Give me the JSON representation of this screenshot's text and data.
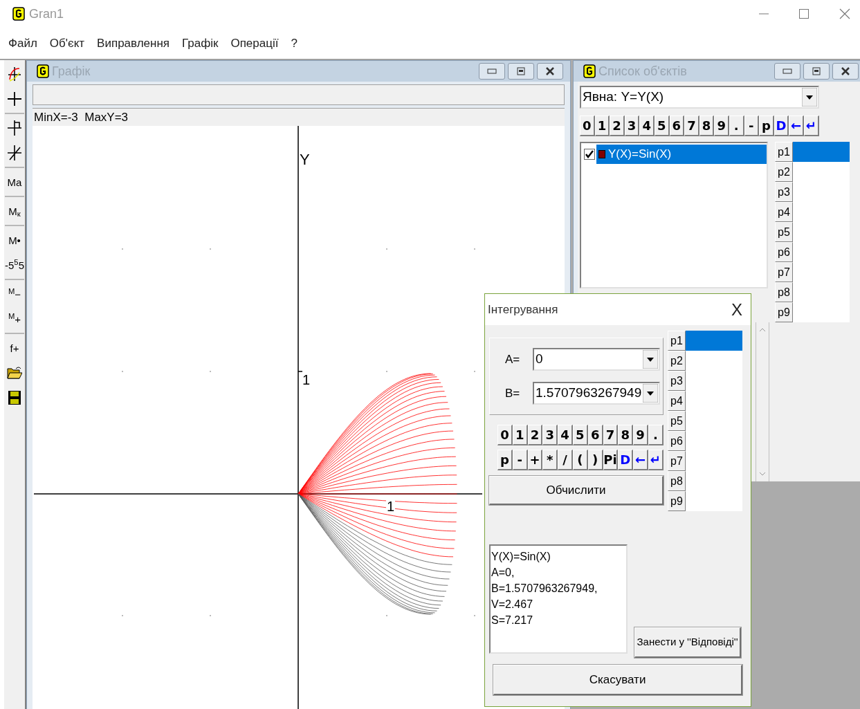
{
  "window": {
    "title": "Gran1"
  },
  "menu": [
    "Файл",
    "Об'єкт",
    "Виправлення",
    "Графік",
    "Операції",
    "?"
  ],
  "toolbar": [
    {
      "kind": "curve"
    },
    {
      "kind": "cross"
    },
    {
      "kind": "separator"
    },
    {
      "kind": "cross-flag"
    },
    {
      "kind": "cross-slash"
    },
    {
      "kind": "separator"
    },
    {
      "kind": "glyph",
      "label": "Ma"
    },
    {
      "kind": "separator"
    },
    {
      "kind": "glyph",
      "label": "M$_{к}$"
    },
    {
      "kind": "separator"
    },
    {
      "kind": "glyph",
      "label": "M•"
    },
    {
      "kind": "glyph",
      "label": "-5$^{5}$5"
    },
    {
      "kind": "separator"
    },
    {
      "kind": "glyph",
      "label": "$^{M}$−"
    },
    {
      "kind": "glyph",
      "label": "$^{M}$+"
    },
    {
      "kind": "separator"
    },
    {
      "kind": "glyph",
      "label": "f+"
    },
    {
      "kind": "open"
    },
    {
      "kind": "save"
    }
  ],
  "graph_window": {
    "title": "Графік",
    "status": "MinX=-3  MaxY=3",
    "axis_y_label": "Y",
    "y_tick": "1",
    "x_tick": "1"
  },
  "objects_window": {
    "title": "Список об'єктів",
    "type_combo": "Явна: Y=Y(X)",
    "keys": [
      {
        "label": "0",
        "color": "#000000"
      },
      {
        "label": "1",
        "color": "#000000"
      },
      {
        "label": "2",
        "color": "#000000"
      },
      {
        "label": "3",
        "color": "#000000"
      },
      {
        "label": "4",
        "color": "#000000"
      },
      {
        "label": "5",
        "color": "#000000"
      },
      {
        "label": "6",
        "color": "#000000"
      },
      {
        "label": "7",
        "color": "#000000"
      },
      {
        "label": "8",
        "color": "#000000"
      },
      {
        "label": "9",
        "color": "#000000"
      },
      {
        "label": ".",
        "color": "#000000"
      },
      {
        "label": "-",
        "color": "#000000"
      },
      {
        "label": "p",
        "color": "#000000"
      },
      {
        "label": "D",
        "color": "#0000ff"
      },
      {
        "label": "←",
        "color": "#0000ff"
      },
      {
        "label": "↵",
        "color": "#0000ff"
      }
    ],
    "objects": [
      {
        "label": "Y(X)=Sin(X)",
        "checked": true,
        "selected": true,
        "color": "#800000"
      }
    ],
    "params": [
      {
        "label": "p1",
        "selected": true
      },
      {
        "label": "p2",
        "selected": false
      },
      {
        "label": "p3",
        "selected": false
      },
      {
        "label": "p4",
        "selected": false
      },
      {
        "label": "p5",
        "selected": false
      },
      {
        "label": "p6",
        "selected": false
      },
      {
        "label": "p7",
        "selected": false
      },
      {
        "label": "p8",
        "selected": false
      },
      {
        "label": "p9",
        "selected": false
      }
    ]
  },
  "dialog": {
    "title": "Інтегрування",
    "close": "X",
    "a_label": "A=",
    "a_value": "0",
    "b_label": "B=",
    "b_value": "1.5707963267949",
    "keys_row1": [
      {
        "label": "0",
        "color": "#000000"
      },
      {
        "label": "1",
        "color": "#000000"
      },
      {
        "label": "2",
        "color": "#000000"
      },
      {
        "label": "3",
        "color": "#000000"
      },
      {
        "label": "4",
        "color": "#000000"
      },
      {
        "label": "5",
        "color": "#000000"
      },
      {
        "label": "6",
        "color": "#000000"
      },
      {
        "label": "7",
        "color": "#000000"
      },
      {
        "label": "8",
        "color": "#000000"
      },
      {
        "label": "9",
        "color": "#000000"
      },
      {
        "label": ".",
        "color": "#000000"
      }
    ],
    "keys_row2": [
      {
        "label": "p",
        "color": "#000000"
      },
      {
        "label": "-",
        "color": "#000000"
      },
      {
        "label": "+",
        "color": "#000000"
      },
      {
        "label": "*",
        "color": "#000000"
      },
      {
        "label": "/",
        "color": "#000000"
      },
      {
        "label": "(",
        "color": "#000000"
      },
      {
        "label": ")",
        "color": "#000000"
      },
      {
        "label": "Pi",
        "color": "#000000"
      },
      {
        "label": "D",
        "color": "#0000ff"
      },
      {
        "label": "←",
        "color": "#0000ff"
      },
      {
        "label": "↵",
        "color": "#0000ff"
      }
    ],
    "calculate": "Обчислити",
    "params": [
      {
        "label": "p1",
        "selected": true
      },
      {
        "label": "p2",
        "selected": false
      },
      {
        "label": "p3",
        "selected": false
      },
      {
        "label": "p4",
        "selected": false
      },
      {
        "label": "p5",
        "selected": false
      },
      {
        "label": "p6",
        "selected": false
      },
      {
        "label": "p7",
        "selected": false
      },
      {
        "label": "p8",
        "selected": false
      },
      {
        "label": "p9",
        "selected": false
      }
    ],
    "result_lines": [
      "Y(X)=Sin(X)",
      "A=0,",
      "B=1.5707963267949,",
      "V=2.467",
      "S=7.217"
    ],
    "save_answer": "Занести у ''Відповіді''",
    "cancel": "Скасувати"
  }
}
